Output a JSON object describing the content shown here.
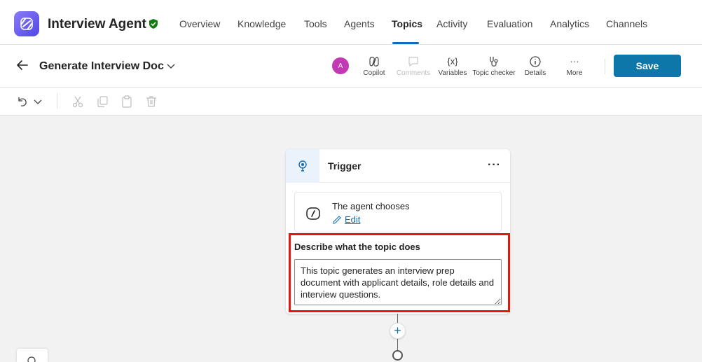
{
  "app": {
    "title": "Interview Agent",
    "logo_icon": "copilot-agent-logo-icon",
    "verified_icon": "shield-check-icon"
  },
  "nav": {
    "items": [
      "Overview",
      "Knowledge",
      "Tools",
      "Agents",
      "Topics",
      "Activity",
      "Evaluation",
      "Analytics",
      "Channels"
    ],
    "active": "Topics"
  },
  "topic": {
    "title": "Generate Interview Doc",
    "avatar_initial": "A"
  },
  "toolbar": {
    "copilot": "Copilot",
    "comments": "Comments",
    "variables_glyph": "{x}",
    "variables": "Variables",
    "topic_checker": "Topic checker",
    "details": "Details",
    "more_glyph": "···",
    "more": "More",
    "save": "Save"
  },
  "trigger": {
    "title": "Trigger",
    "more": "···",
    "agent_chooses": "The agent chooses",
    "edit": "Edit",
    "describe_label": "Describe what the topic does",
    "description": "This topic generates an interview prep document with applicant details, role details and interview questions."
  },
  "colors": {
    "accent": "#0e77a9",
    "link": "#0f6cbd",
    "highlight": "#e0190e",
    "avatar": "#c239b3"
  }
}
